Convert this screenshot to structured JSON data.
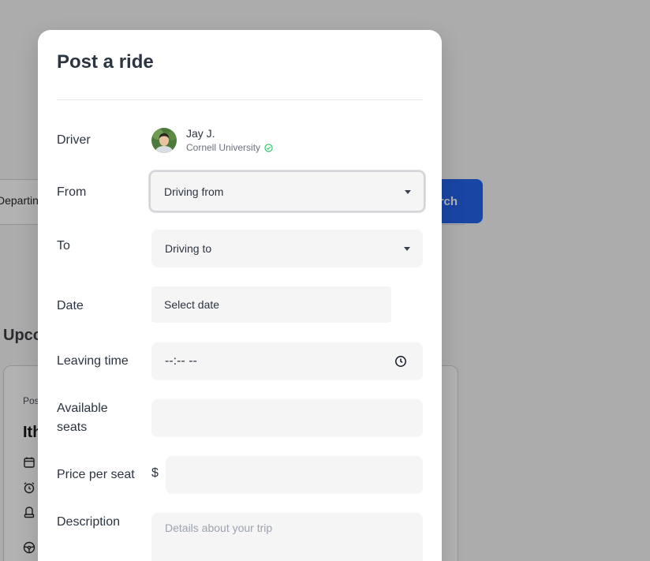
{
  "background": {
    "search_bar": {
      "departing_label": "Departin",
      "search_button_label": "rch"
    },
    "upcoming_heading": "Upco",
    "card": {
      "posted_label": "Pos",
      "city": "Ith"
    }
  },
  "modal": {
    "title": "Post a ride",
    "driver": {
      "label": "Driver",
      "name": "Jay J.",
      "school": "Cornell University",
      "verified_icon": "check-circle-icon"
    },
    "from": {
      "label": "From",
      "value": "Driving from"
    },
    "to": {
      "label": "To",
      "value": "Driving to"
    },
    "date": {
      "label": "Date",
      "value": "Select date"
    },
    "leaving_time": {
      "label": "Leaving time",
      "value": "--:-- --"
    },
    "available_seats": {
      "label": "Available seats",
      "value": ""
    },
    "price": {
      "label": "Price per seat",
      "currency": "$",
      "value": ""
    },
    "description": {
      "label": "Description",
      "placeholder": "Details about your trip"
    }
  },
  "colors": {
    "accent": "#2563eb",
    "verified": "#22c55e",
    "text": "#2b3440",
    "field_bg": "#f5f5f5"
  }
}
